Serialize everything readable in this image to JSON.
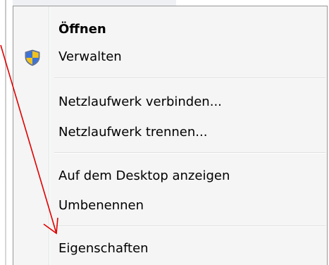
{
  "context_menu": {
    "items": [
      {
        "label": "Öffnen",
        "bold": true,
        "icon": null
      },
      {
        "label": "Verwalten",
        "bold": false,
        "icon": "shield-icon"
      },
      {
        "label": "Netzlaufwerk verbinden...",
        "bold": false,
        "icon": null
      },
      {
        "label": "Netzlaufwerk trennen...",
        "bold": false,
        "icon": null
      },
      {
        "label": "Auf dem Desktop anzeigen",
        "bold": false,
        "icon": null
      },
      {
        "label": "Umbenennen",
        "bold": false,
        "icon": null
      },
      {
        "label": "Eigenschaften",
        "bold": false,
        "icon": null
      }
    ]
  },
  "annotation": {
    "arrow_color": "#e00000",
    "points_to": "Eigenschaften"
  },
  "colors": {
    "menu_background": "#f5f5f5",
    "menu_border": "#979797",
    "separator": "#e0e0e0"
  }
}
